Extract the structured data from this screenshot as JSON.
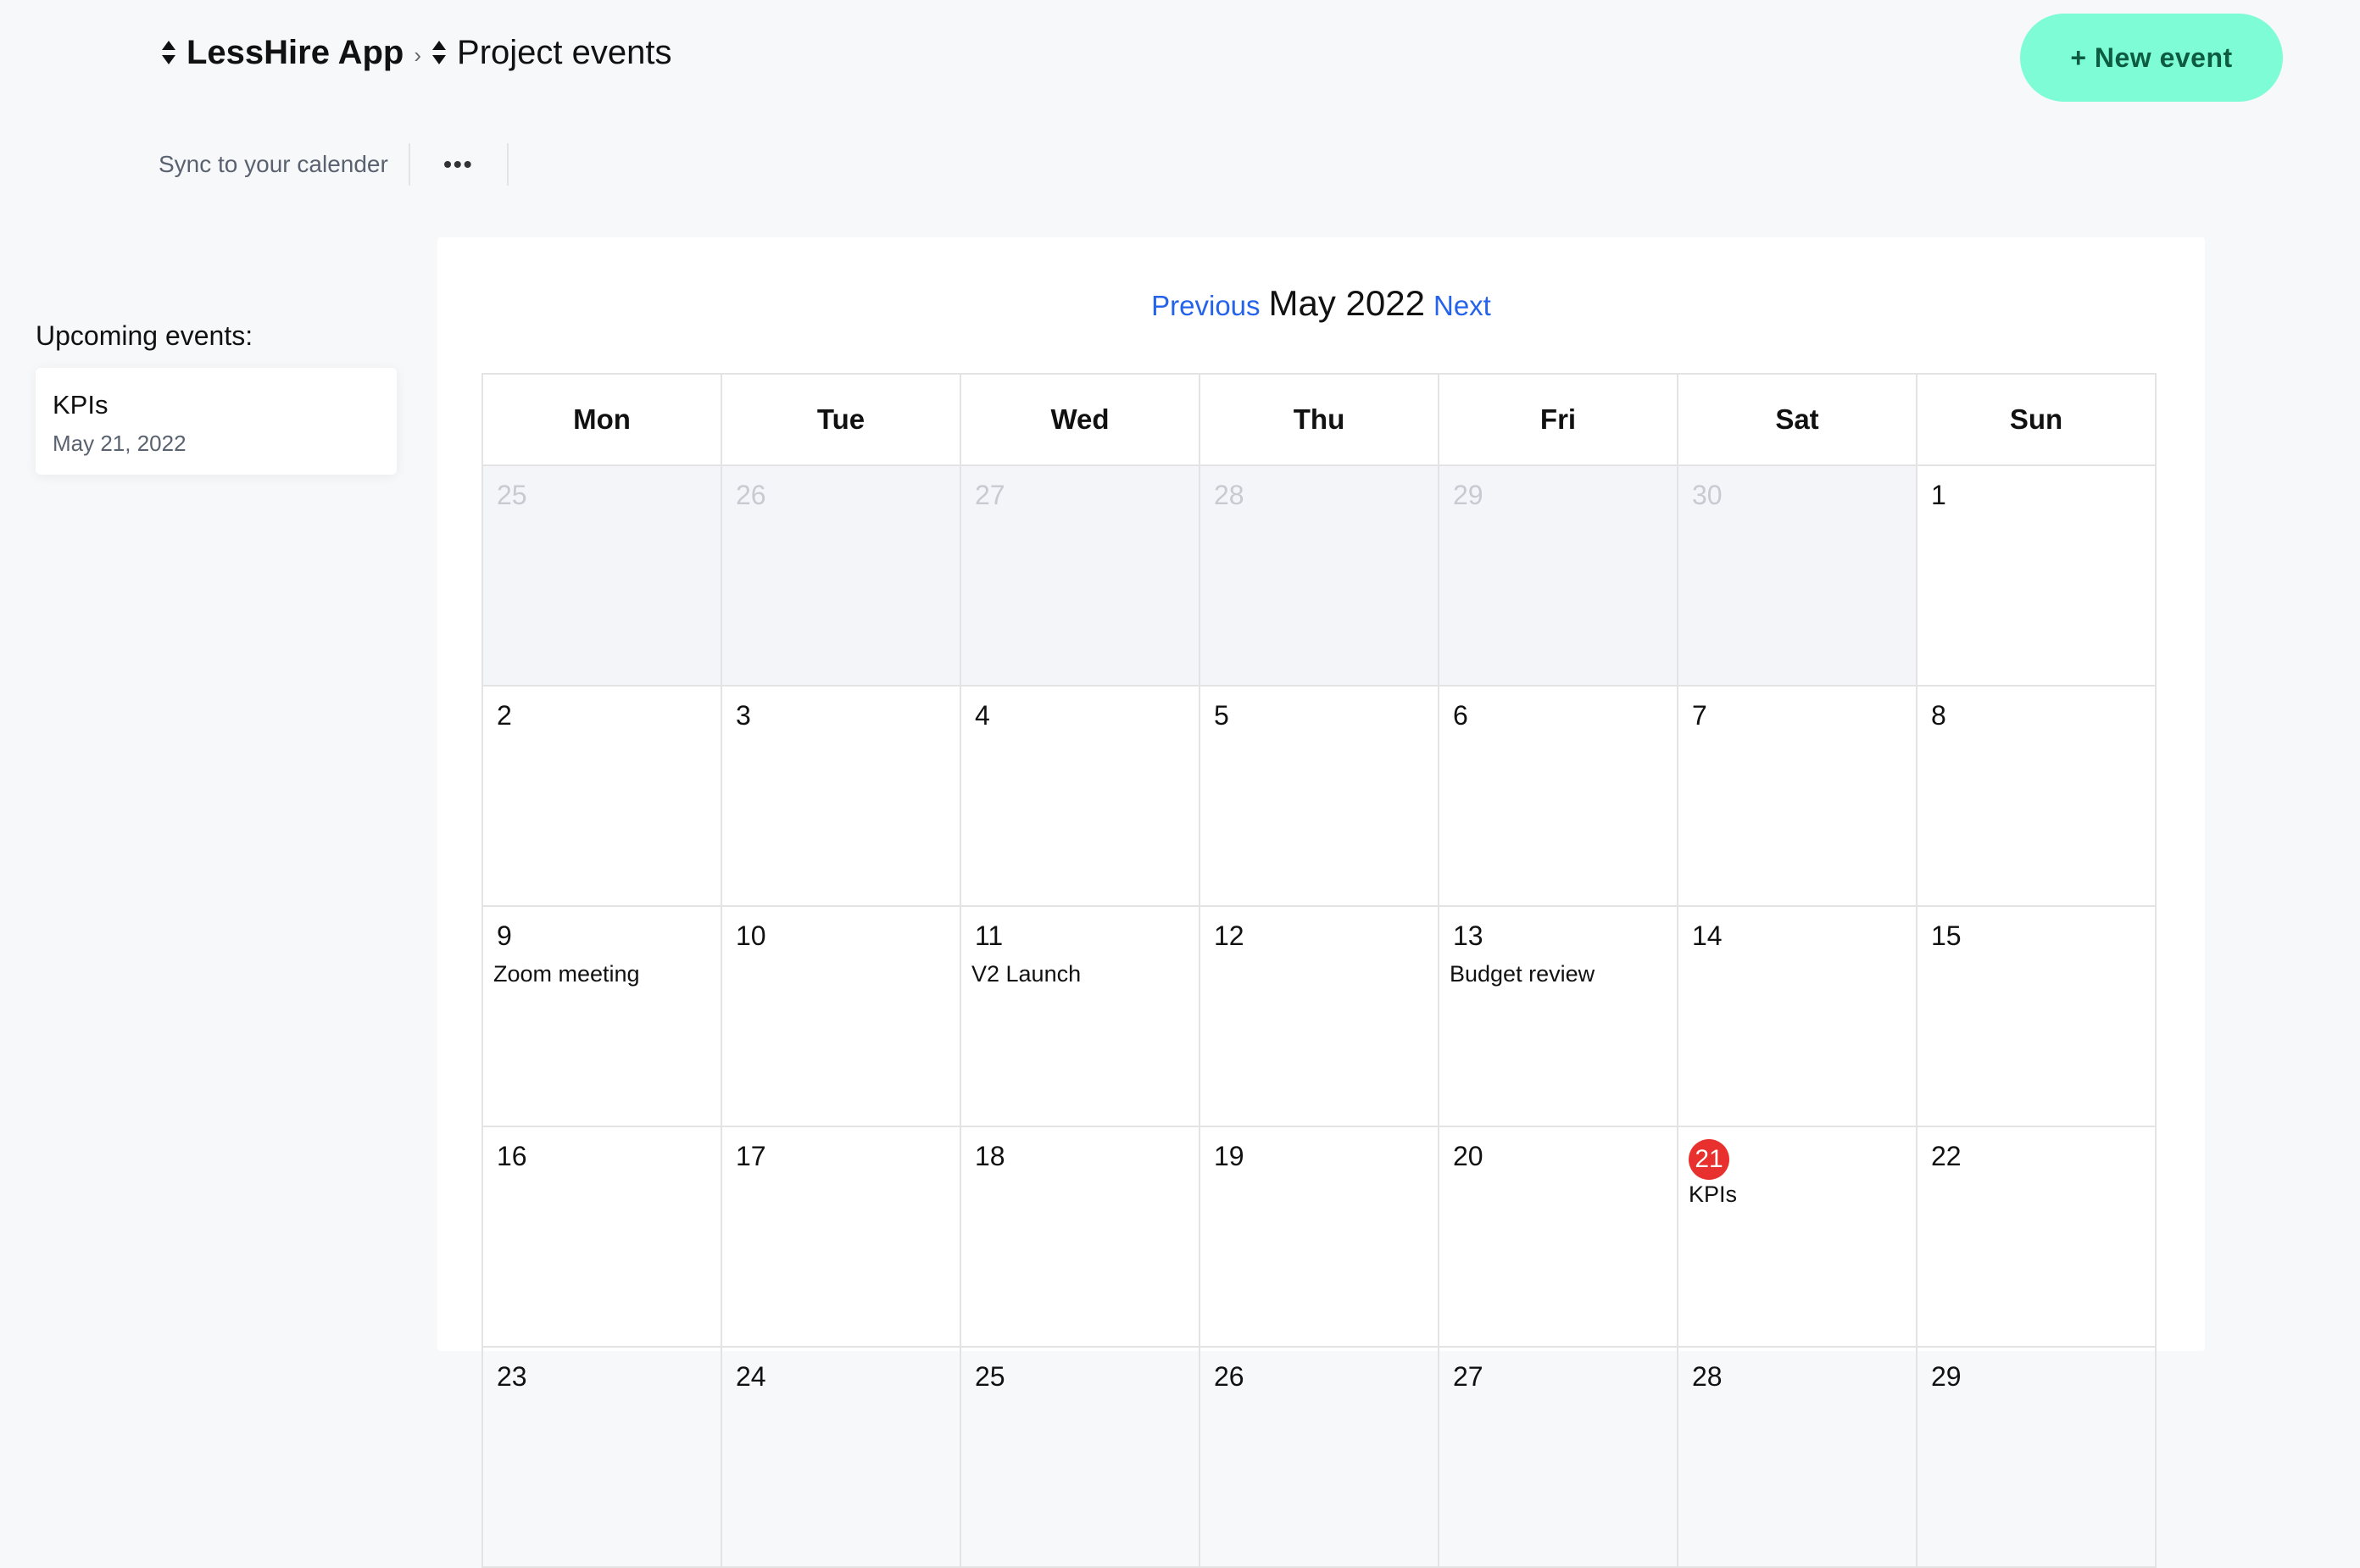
{
  "breadcrumb": {
    "app": "LessHire App",
    "separator": "›",
    "project": "Project events"
  },
  "actions": {
    "new_event": "+ New event",
    "sync": "Sync to your calender",
    "more": "•••"
  },
  "upcoming": {
    "title": "Upcoming events:",
    "items": [
      {
        "title": "KPIs",
        "date": "May 21, 2022"
      }
    ]
  },
  "calendar": {
    "prev": "Previous",
    "month": "May 2022",
    "next": "Next",
    "weekdays": [
      "Mon",
      "Tue",
      "Wed",
      "Thu",
      "Fri",
      "Sat",
      "Sun"
    ],
    "weeks": [
      [
        {
          "day": "25",
          "outside": true
        },
        {
          "day": "26",
          "outside": true
        },
        {
          "day": "27",
          "outside": true
        },
        {
          "day": "28",
          "outside": true
        },
        {
          "day": "29",
          "outside": true
        },
        {
          "day": "30",
          "outside": true
        },
        {
          "day": "1"
        }
      ],
      [
        {
          "day": "2"
        },
        {
          "day": "3"
        },
        {
          "day": "4"
        },
        {
          "day": "5"
        },
        {
          "day": "6"
        },
        {
          "day": "7"
        },
        {
          "day": "8"
        }
      ],
      [
        {
          "day": "9",
          "event": "Zoom meeting"
        },
        {
          "day": "10"
        },
        {
          "day": "11",
          "event": "V2 Launch"
        },
        {
          "day": "12"
        },
        {
          "day": "13",
          "event": "Budget review"
        },
        {
          "day": "14"
        },
        {
          "day": "15"
        }
      ],
      [
        {
          "day": "16"
        },
        {
          "day": "17"
        },
        {
          "day": "18"
        },
        {
          "day": "19"
        },
        {
          "day": "20"
        },
        {
          "day": "21",
          "event": "KPIs",
          "today": true
        },
        {
          "day": "22"
        }
      ],
      [
        {
          "day": "23"
        },
        {
          "day": "24"
        },
        {
          "day": "25"
        },
        {
          "day": "26"
        },
        {
          "day": "27"
        },
        {
          "day": "28"
        },
        {
          "day": "29"
        }
      ]
    ]
  },
  "colors": {
    "accent": "#7dfcd6",
    "accent_text": "#0d5b40",
    "link": "#2563eb",
    "today": "#e8302f"
  }
}
